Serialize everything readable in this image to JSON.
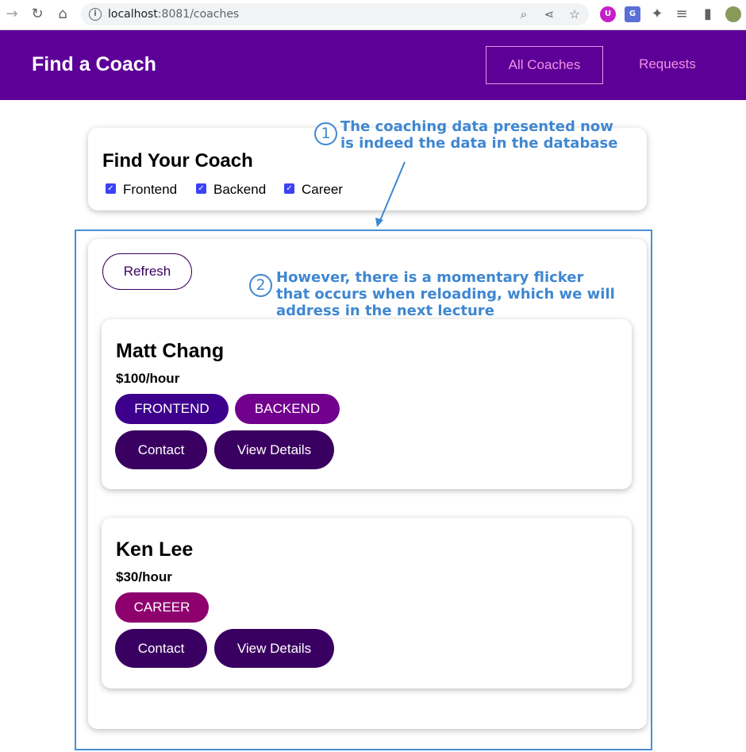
{
  "browser": {
    "url_host": "localhost",
    "url_rest": ":8081/coaches"
  },
  "header": {
    "title": "Find a Coach",
    "nav": [
      "All Coaches",
      "Requests"
    ]
  },
  "filter": {
    "title": "Find Your Coach",
    "options": [
      {
        "label": "Frontend",
        "checked": true
      },
      {
        "label": "Backend",
        "checked": true
      },
      {
        "label": "Career",
        "checked": true
      }
    ]
  },
  "list": {
    "refresh_label": "Refresh",
    "coaches": [
      {
        "name": "Matt Chang",
        "rate": "$100/hour",
        "areas": [
          "FRONTEND",
          "BACKEND"
        ],
        "contact_label": "Contact",
        "details_label": "View Details"
      },
      {
        "name": "Ken Lee",
        "rate": "$30/hour",
        "areas": [
          "CAREER"
        ],
        "contact_label": "Contact",
        "details_label": "View Details"
      }
    ]
  },
  "annotations": [
    {
      "number": "1",
      "lines": [
        "The coaching data presented now",
        "is indeed the data in the database"
      ]
    },
    {
      "number": "2",
      "lines": [
        "However, there is a momentary flicker",
        "that occurs when reloading, which we will",
        "address in the next lecture"
      ]
    }
  ],
  "colors": {
    "header_bg": "#5c0097",
    "nav_link": "#f391e3",
    "frontend_badge": "#3d008d",
    "backend_badge": "#71008f",
    "career_badge": "#8d006e",
    "button_bg": "#3a0061",
    "annotation": "#3f87d1"
  }
}
